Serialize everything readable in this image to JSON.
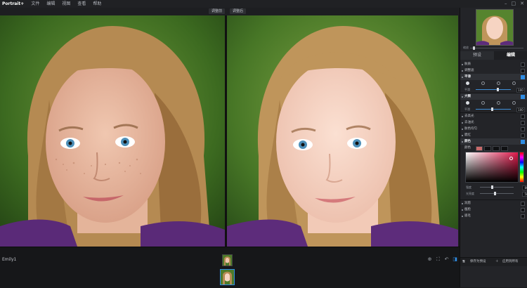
{
  "menubar": {
    "app_title": "Portrait+",
    "items": [
      "文件",
      "编辑",
      "视图",
      "查看",
      "帮助"
    ]
  },
  "window_controls": [
    "–",
    "□",
    "✕"
  ],
  "panes": {
    "before_label": "调整前",
    "after_label": "调整后"
  },
  "bottom": {
    "file_name": "Emily1"
  },
  "panel": {
    "zoom_label": "缩放",
    "tabs": [
      "预设",
      "编辑"
    ],
    "sections": {
      "r1": "肤质",
      "r2": "调整滤",
      "r3": "平滑",
      "slider1_label": "平滑",
      "r4": "大颗",
      "slider2_label": "平滑",
      "r5": "去高光",
      "r6": "去油光",
      "r7": "肤色均匀",
      "r8": "腮红",
      "r9": "颜色",
      "color_label": "颜色",
      "blend_label": "强度",
      "brightness_label": "光亮度",
      "r10": "润唇",
      "r11": "瘦脸",
      "r12": "眉毛"
    },
    "values": {
      "slider1": "100",
      "slider2": "100",
      "blend": "80",
      "brightness": "50"
    },
    "footer": {
      "save_label": "保存为预设",
      "apply_label": "应用到所有"
    }
  },
  "colors": {
    "accent": "#2f8de4",
    "panel_bg": "#232428"
  }
}
